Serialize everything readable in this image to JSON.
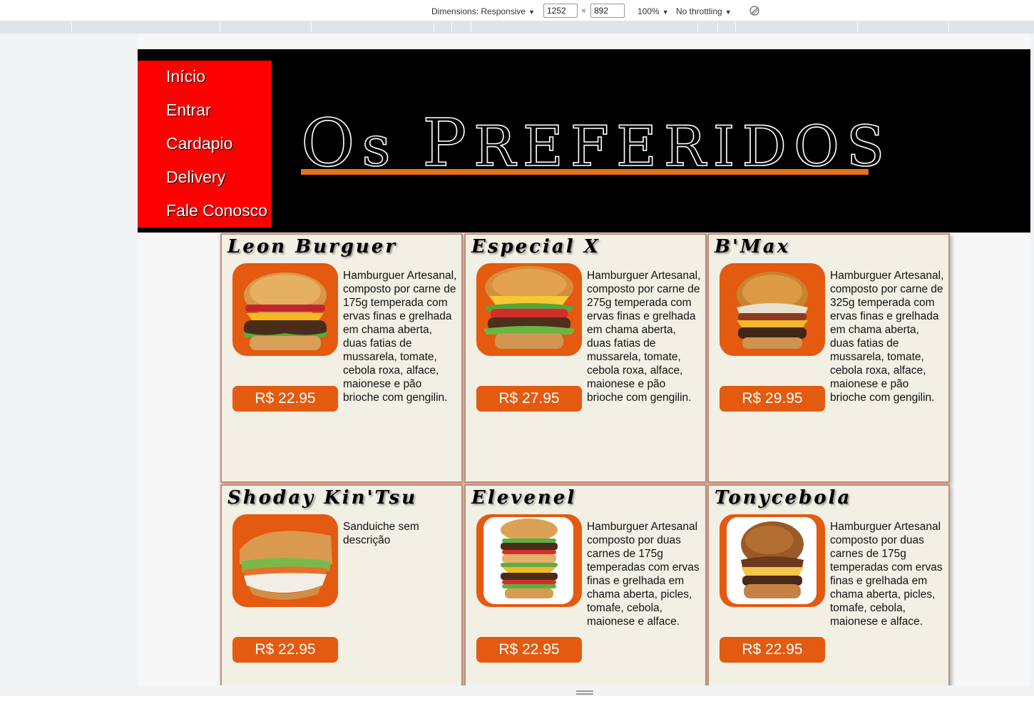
{
  "devtools": {
    "dimensions_label": "Dimensions: Responsive",
    "width_value": "1252",
    "height_value": "892",
    "times": "×",
    "zoom": "100%",
    "throttling": "No throttling",
    "caret": "▼"
  },
  "nav": {
    "items": [
      "Início",
      "Entrar",
      "Cardapio",
      "Delivery",
      "Fale Conosco"
    ]
  },
  "brand": {
    "initial_1": "O",
    "rest_1": "s",
    "initial_2": "P",
    "rest_2": "referidos",
    "line_color": "#e8701a"
  },
  "colors": {
    "nav_bg": "#ff0000",
    "header_bg": "#000000",
    "card_bg": "#f2efe4",
    "accent": "#e35a10"
  },
  "products": [
    {
      "name": "Leon Burguer",
      "description": "Hamburguer Artesanal, composto por carne de 175g temperada com ervas finas e grelhada em chama aberta, duas fatias de mussarela, tomate, cebola roxa, alface, maionese e pão brioche com gengilin.",
      "price": "R$ 22.95"
    },
    {
      "name": "Especial X",
      "description": "Hamburguer Artesanal, composto por carne de 275g temperada com ervas finas e grelhada em chama aberta, duas fatias de mussarela, tomate, cebola roxa, alface, maionese e pão brioche com gengilin.",
      "price": "R$ 27.95"
    },
    {
      "name": "B'Max",
      "description": "Hamburguer Artesanal, composto por carne de 325g temperada com ervas finas e grelhada em chama aberta, duas fatias de mussarela, tomate, cebola roxa, alface, maionese e pão brioche com gengilin.",
      "price": "R$ 29.95"
    },
    {
      "name": "Shoday Kin'Tsu",
      "description": "Sanduiche sem descrição",
      "price": "R$ 22.95"
    },
    {
      "name": "Elevenel",
      "description": "Hamburguer Artesanal composto por duas carnes de 175g temperadas com ervas finas e grelhada em chama aberta, picles, tomafe, cebola, maionese e alface.",
      "price": "R$ 22.95"
    },
    {
      "name": "Tonycebola",
      "description": "Hamburguer Artesanal composto por duas carnes de 175g temperadas com ervas finas e grelhada em chama aberta, picles, tomafe, cebola, maionese e alface.",
      "price": "R$ 22.95"
    }
  ]
}
